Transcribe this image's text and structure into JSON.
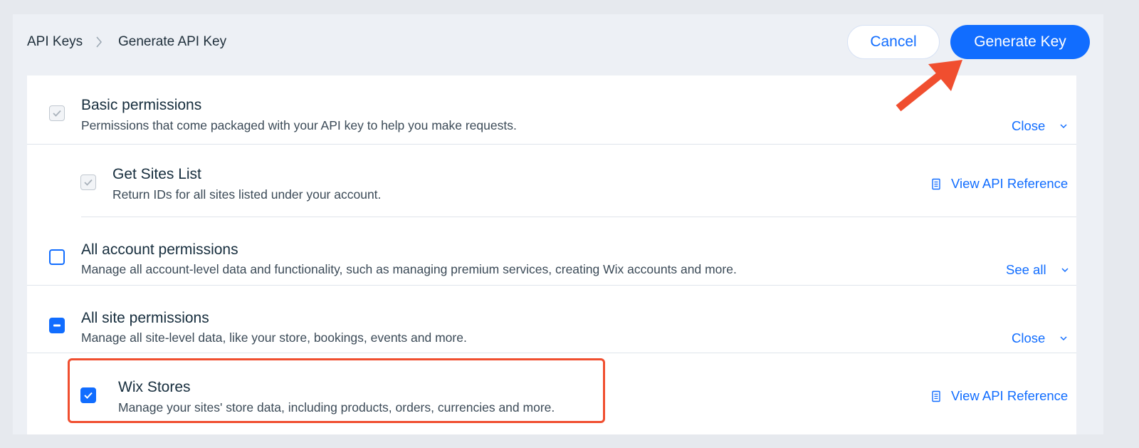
{
  "breadcrumb": {
    "items": [
      "API Keys",
      "Generate API Key"
    ]
  },
  "header": {
    "cancel_label": "Cancel",
    "generate_label": "Generate Key"
  },
  "permissions": {
    "basic": {
      "title": "Basic permissions",
      "description": "Permissions that come packaged with your API key to help you make requests.",
      "toggle_label": "Close",
      "checked": "disabled-checked"
    },
    "get_sites": {
      "title": "Get Sites List",
      "description": "Return IDs for all sites listed under your account.",
      "link_label": "View API Reference",
      "checked": "disabled-checked"
    },
    "account": {
      "title": "All account permissions",
      "description": "Manage all account-level data and functionality, such as managing premium services, creating Wix accounts and more.",
      "toggle_label": "See all",
      "checked": "unchecked"
    },
    "site": {
      "title": "All site permissions",
      "description": "Manage all site-level data, like your store, bookings, events and more.",
      "toggle_label": "Close",
      "checked": "indeterminate"
    },
    "wix_stores": {
      "title": "Wix Stores",
      "description": "Manage your sites' store data, including products, orders, currencies and more.",
      "link_label": "View API Reference",
      "checked": "checked"
    }
  },
  "colors": {
    "accent": "#116dff",
    "annotation": "#f04e2f",
    "background": "#edf0f5"
  },
  "icons": [
    "chevron-right-icon",
    "chevron-down-icon",
    "document-icon",
    "checkmark-icon",
    "minus-icon",
    "arrow-annotation-icon"
  ]
}
